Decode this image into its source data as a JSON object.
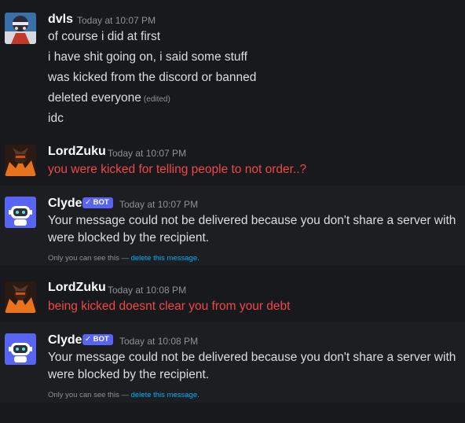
{
  "messages": [
    {
      "username": "dvls",
      "timestamp": "Today at 10:07 PM",
      "lines": [
        "of course i did at first",
        "i have shit going on, i said some stuff",
        "was kicked from the discord or banned",
        "deleted everyone",
        "idc"
      ],
      "edited_label": "(edited)"
    },
    {
      "username": "LordZuku",
      "timestamp": "Today at 10:07 PM",
      "text": "you were kicked for telling people to not order..?",
      "text_color": "#f04747"
    },
    {
      "username": "Clyde",
      "badge": "BOT",
      "timestamp": "Today at 10:07 PM",
      "line1": "Your message could not be delivered because you don't share a server with",
      "line2": "were blocked by the recipient.",
      "ephemeral_text": "Only you can see this — ",
      "ephemeral_link": "delete this message."
    },
    {
      "username": "LordZuku",
      "timestamp": "Today at 10:08 PM",
      "text": "being kicked doesnt clear you from your debt",
      "text_color": "#f04747"
    },
    {
      "username": "Clyde",
      "badge": "BOT",
      "timestamp": "Today at 10:08 PM",
      "line1": "Your message could not be delivered because you don't share a server with",
      "line2": "were blocked by the recipient.",
      "ephemeral_text": "Only you can see this — ",
      "ephemeral_link": "delete this message."
    }
  ],
  "colors": {
    "background": "#18191c",
    "bot_background": "#1d1e22",
    "username": "#ffffff",
    "text": "#dcddde",
    "muted": "#8e9297",
    "link": "#00aff4",
    "badge": "#5865f2"
  },
  "icons": {
    "bot_check": "checkmark-icon",
    "clyde_avatar": "robot-icon"
  }
}
